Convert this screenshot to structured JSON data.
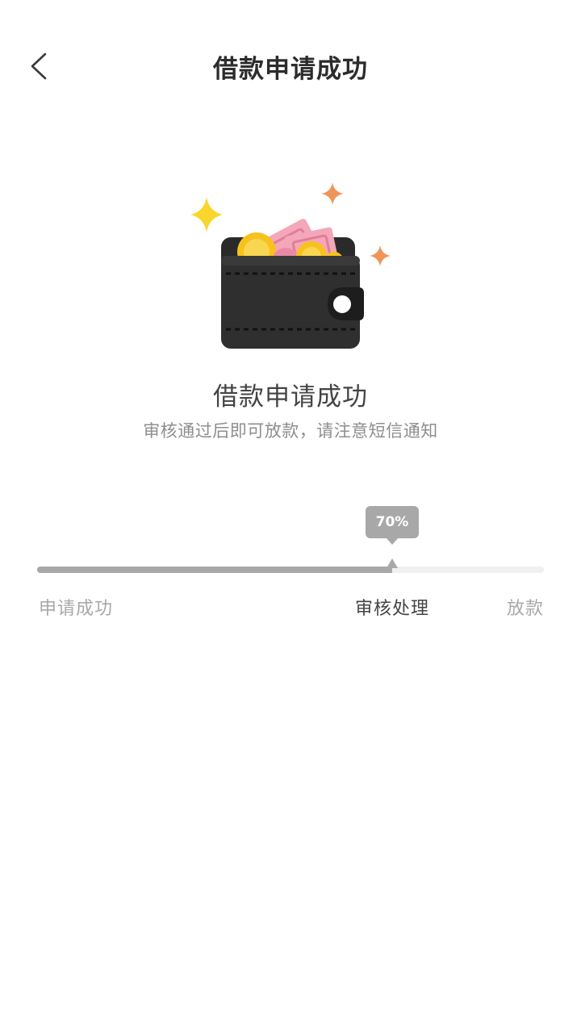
{
  "header": {
    "title": "借款申请成功",
    "back_icon": "chevron-left-icon"
  },
  "illustration": {
    "icon": "wallet-icon",
    "colors": {
      "wallet": "#2f2f2f",
      "bills": "#f4a7b9",
      "coins": "#f7c21b",
      "sparkle_yellow": "#f9d62e",
      "sparkle_orange": "#f0955a"
    }
  },
  "result": {
    "title": "借款申请成功",
    "subtitle": "审核通过后即可放款，请注意短信通知"
  },
  "progress": {
    "percent_label": "70%",
    "percent_value": 70,
    "steps": [
      {
        "label": "申请成功",
        "state": "done"
      },
      {
        "label": "审核处理",
        "state": "current"
      },
      {
        "label": "放款",
        "state": "pending"
      }
    ]
  }
}
